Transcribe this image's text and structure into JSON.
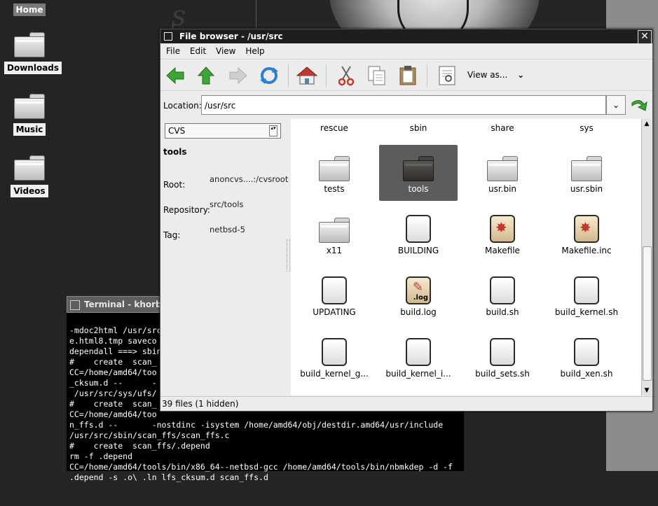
{
  "desktop": {
    "icons": [
      {
        "label": "Home"
      },
      {
        "label": "Downloads"
      },
      {
        "label": "Music"
      },
      {
        "label": "Videos"
      }
    ]
  },
  "terminal": {
    "title": "Terminal - khorb",
    "lines": [
      "-mdoc2html /usr/src",
      "e.html8.tmp saveco",
      "dependall ===> sbin",
      "#    create  scan_",
      "CC=/home/amd64/too",
      "_cksum.d --      -",
      " /usr/src/sys/ufs/",
      "#    create  scan_",
      "CC=/home/amd64/too",
      "n_ffs.d --       -nostdinc -isystem /home/amd64/obj/destdir.amd64/usr/include",
      "/usr/src/sbin/scan_ffs/scan_ffs.c",
      "#    create  scan_ffs/.depend",
      "rm -f .depend",
      "CC=/home/amd64/tools/bin/x86_64--netbsd-gcc /home/amd64/tools/bin/nbmkdep -d -f",
      ".depend -s .o\\ .ln lfs_cksum.d scan_ffs.d"
    ]
  },
  "file_browser": {
    "title": "File browser - /usr/src",
    "close_glyph": "✕",
    "menu": [
      "File",
      "Edit",
      "View",
      "Help"
    ],
    "toolbar": {
      "view_as_label": "View as...",
      "view_as_chevron": "⌄"
    },
    "location": {
      "label": "Location:",
      "value": "/usr/src",
      "dropdown_glyph": "⌄"
    },
    "side_panel": {
      "selector": "CVS",
      "selector_arrows": "▴▾",
      "title": "tools",
      "fields": [
        {
          "key": "Root:",
          "value": "anoncvs....:/cvsroot"
        },
        {
          "key": "Repository:",
          "value": "src/tools"
        },
        {
          "key": "Tag:",
          "value": "netbsd-5"
        }
      ]
    },
    "items": [
      {
        "label": "rescue",
        "type": "folder"
      },
      {
        "label": "sbin",
        "type": "folder"
      },
      {
        "label": "share",
        "type": "folder"
      },
      {
        "label": "sys",
        "type": "folder"
      },
      {
        "label": "tests",
        "type": "folder"
      },
      {
        "label": "tools",
        "type": "folder",
        "selected": true
      },
      {
        "label": "usr.bin",
        "type": "folder"
      },
      {
        "label": "usr.sbin",
        "type": "folder"
      },
      {
        "label": "x11",
        "type": "folder"
      },
      {
        "label": "BUILDING",
        "type": "file"
      },
      {
        "label": "Makefile",
        "type": "makefile"
      },
      {
        "label": "Makefile.inc",
        "type": "makefile"
      },
      {
        "label": "UPDATING",
        "type": "file"
      },
      {
        "label": "build.log",
        "type": "log",
        "tag": ".log"
      },
      {
        "label": "build.sh",
        "type": "file"
      },
      {
        "label": "build_kernel.sh",
        "type": "file"
      },
      {
        "label": "build_kernel_g...",
        "type": "file"
      },
      {
        "label": "build_kernel_i...",
        "type": "file"
      },
      {
        "label": "build_sets.sh",
        "type": "file"
      },
      {
        "label": "build_xen.sh",
        "type": "file"
      }
    ],
    "status": "39 files (1 hidden)",
    "scroll_up_glyph": "▲",
    "scroll_down_glyph": "▼",
    "colors": {
      "selection": "#5c5c5c",
      "back_arrow": "#3fa535",
      "home_roof": "#c0392b"
    }
  }
}
